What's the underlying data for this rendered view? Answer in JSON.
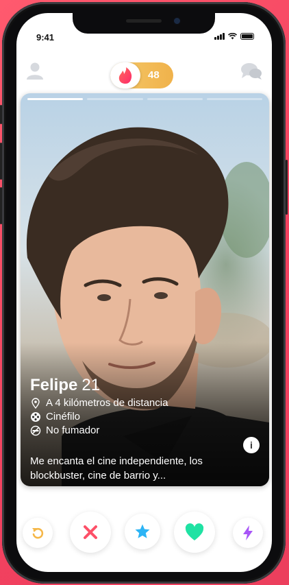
{
  "status_bar": {
    "time": "9:41"
  },
  "header": {
    "boost_count": "48",
    "icons": [
      "profile-icon",
      "flame-icon",
      "chat-icon"
    ]
  },
  "card": {
    "photo_index": 1,
    "photo_count": 4,
    "name": "Felipe",
    "age": "21",
    "details": [
      {
        "icon": "location-pin-icon",
        "text": "A 4 kilómetros de distancia"
      },
      {
        "icon": "film-reel-icon",
        "text": "Cinéfilo"
      },
      {
        "icon": "no-smoking-icon",
        "text": "No fumador"
      }
    ],
    "bio": "Me encanta el cine independiente, los blockbuster, cine de barrio y...",
    "info_button": "i"
  },
  "actions": [
    {
      "name": "rewind-button",
      "icon": "rewind-icon",
      "color": "#f5b748"
    },
    {
      "name": "nope-button",
      "icon": "close-icon",
      "color": "#fd5068"
    },
    {
      "name": "super-like-button",
      "icon": "star-icon",
      "color": "#2db4f5"
    },
    {
      "name": "like-button",
      "icon": "heart-icon",
      "color": "#1fe2a3"
    },
    {
      "name": "boost-button",
      "icon": "lightning-icon",
      "color": "#a855f7"
    }
  ],
  "colors": {
    "brand": "#fe3c72",
    "background": "#ec3f5d"
  }
}
